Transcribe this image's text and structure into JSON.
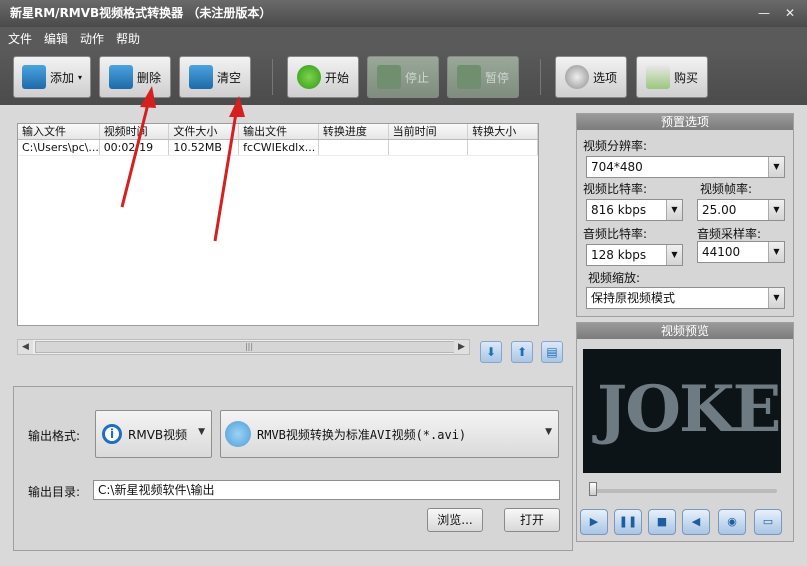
{
  "window": {
    "title": "新星RM/RMVB视频格式转换器 （未注册版本）",
    "min": "—",
    "close": "✕"
  },
  "menu": [
    "文件",
    "编辑",
    "动作",
    "帮助"
  ],
  "toolbar": {
    "add": "添加",
    "delete": "删除",
    "clear": "清空",
    "start": "开始",
    "stop": "停止",
    "pause": "暂停",
    "options": "选项",
    "buy": "购买"
  },
  "list": {
    "headers": [
      "输入文件",
      "视频时间",
      "文件大小",
      "输出文件",
      "转换进度",
      "当前时间",
      "转换大小"
    ],
    "rows": [
      [
        "C:\\Users\\pc\\...",
        "00:02:19",
        "10.52MB",
        "fcCWIEkdlx...",
        "",
        "",
        ""
      ]
    ]
  },
  "output": {
    "format_label": "输出格式:",
    "format_main": "RMVB视频",
    "format_detail": "RMVB视频转换为标准AVI视频(*.avi)",
    "dir_label": "输出目录:",
    "dir_value": "C:\\新星视频软件\\输出",
    "browse": "浏览...",
    "open": "打开"
  },
  "preset": {
    "title": "预置选项",
    "resolution_label": "视频分辨率:",
    "resolution": "704*480",
    "vbitrate_label": "视频比特率:",
    "vbitrate": "816 kbps",
    "framerate_label": "视频帧率:",
    "framerate": "25.00",
    "abitrate_label": "音频比特率:",
    "abitrate": "128 kbps",
    "samplerate_label": "音频采样率:",
    "samplerate": "44100",
    "scale_label": "视频缩放:",
    "scale": "保持原视频模式"
  },
  "preview": {
    "title": "视频预览",
    "poster_text": "JOKER"
  },
  "colors": {
    "arrow": "#d61f1f"
  }
}
